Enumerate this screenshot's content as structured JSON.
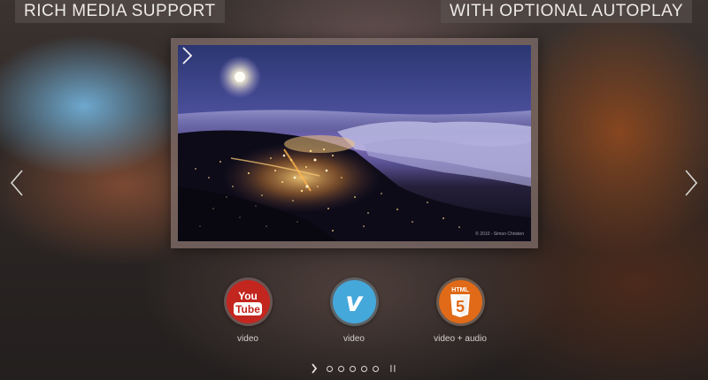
{
  "banners": {
    "left": "RICH MEDIA SUPPORT",
    "right": "WITH OPTIONAL AUTOPLAY"
  },
  "slide": {
    "credit": "© 2010 - Simon Christen"
  },
  "media_items": [
    {
      "icon": "youtube-icon",
      "icon_text_top": "You",
      "icon_text_bottom": "Tube",
      "label": "video"
    },
    {
      "icon": "vimeo-icon",
      "icon_text": "v",
      "label": "video"
    },
    {
      "icon": "html5-icon",
      "icon_text_top": "HTML",
      "icon_text": "5",
      "label": "video + audio"
    }
  ],
  "pagination": {
    "dot_count": 5,
    "current_index": 0
  },
  "colors": {
    "youtube": "#c3261f",
    "vimeo": "#45a8db",
    "html5": "#e06a17"
  }
}
